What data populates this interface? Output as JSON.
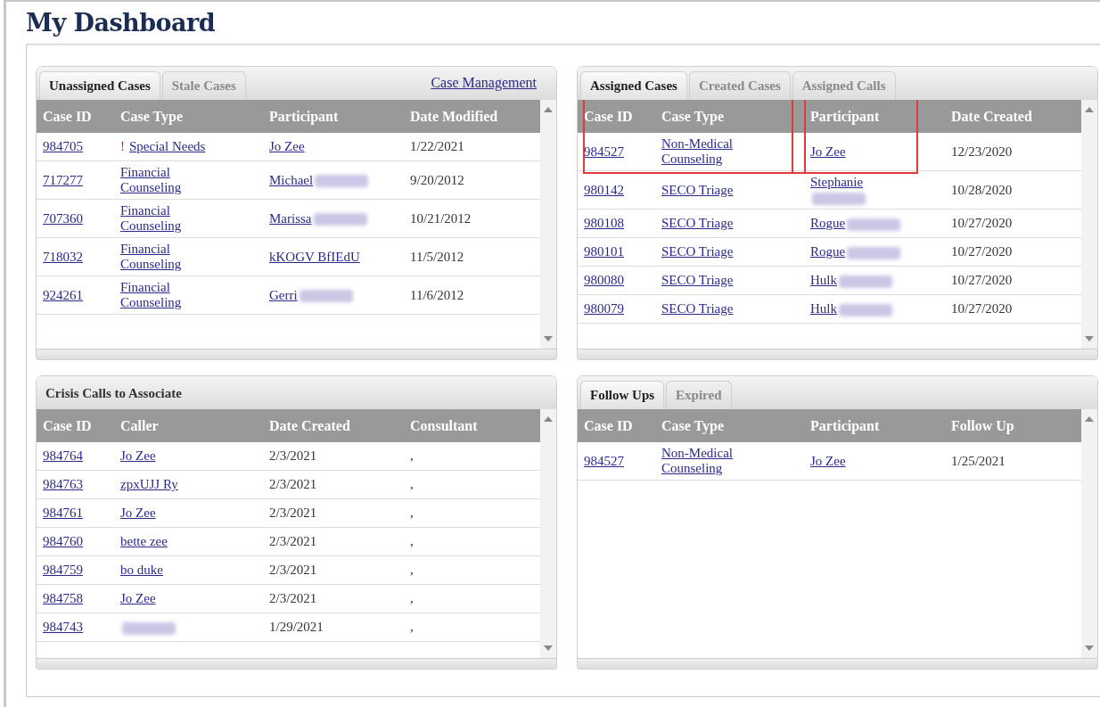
{
  "title": "My Dashboard",
  "panels": [
    {
      "tabs": [
        {
          "label": "Unassigned Cases",
          "selected": true
        },
        {
          "label": "Stale Cases",
          "selected": false
        }
      ],
      "link": "Case Management",
      "columns": [
        {
          "label": "Case ID"
        },
        {
          "label": "Case Type"
        },
        {
          "label": "Participant"
        },
        {
          "label": "Date Modified"
        }
      ],
      "rows": [
        {
          "cells": [
            {
              "text": "984705",
              "link": true
            },
            {
              "text": "Special Needs",
              "link": true,
              "alert": "!"
            },
            {
              "text": "Jo Zee",
              "link": true
            },
            {
              "text": "1/22/2021",
              "link": false
            }
          ]
        },
        {
          "cells": [
            {
              "text": "717277",
              "link": true
            },
            {
              "text": "Financial Counseling",
              "link": true
            },
            {
              "text": "Michael",
              "link": true,
              "redacted": true
            },
            {
              "text": "9/20/2012",
              "link": false
            }
          ]
        },
        {
          "cells": [
            {
              "text": "707360",
              "link": true
            },
            {
              "text": "Financial Counseling",
              "link": true
            },
            {
              "text": "Marissa",
              "link": true,
              "redacted": true
            },
            {
              "text": "10/21/2012",
              "link": false
            }
          ]
        },
        {
          "cells": [
            {
              "text": "718032",
              "link": true
            },
            {
              "text": "Financial Counseling",
              "link": true
            },
            {
              "text": "kKOGV BfIEdU",
              "link": true
            },
            {
              "text": "11/5/2012",
              "link": false
            }
          ]
        },
        {
          "cells": [
            {
              "text": "924261",
              "link": true
            },
            {
              "text": "Financial Counseling",
              "link": true
            },
            {
              "text": "Gerri",
              "link": true,
              "redacted": true
            },
            {
              "text": "11/6/2012",
              "link": false
            }
          ]
        }
      ]
    },
    {
      "tabs": [
        {
          "label": "Assigned Cases",
          "selected": true
        },
        {
          "label": "Created Cases",
          "selected": false
        },
        {
          "label": "Assigned Calls",
          "selected": false
        }
      ],
      "columns": [
        {
          "label": "Case ID",
          "highlighted": true
        },
        {
          "label": "Case Type",
          "highlighted": true,
          "frame_start": false
        },
        {
          "label": "Participant",
          "highlighted": true,
          "frame_start": true
        },
        {
          "label": "Date Created"
        }
      ],
      "rows": [
        {
          "cells": [
            {
              "text": "984527",
              "link": true
            },
            {
              "text": "Non-Medical Counseling",
              "link": true
            },
            {
              "text": "Jo Zee",
              "link": true
            },
            {
              "text": "12/23/2020",
              "link": false
            }
          ]
        },
        {
          "cells": [
            {
              "text": "980142",
              "link": true
            },
            {
              "text": "SECO Triage",
              "link": true
            },
            {
              "text": "Stephanie",
              "link": true,
              "redacted": true,
              "wrap": true
            },
            {
              "text": "10/28/2020",
              "link": false
            }
          ]
        },
        {
          "cells": [
            {
              "text": "980108",
              "link": true
            },
            {
              "text": "SECO Triage",
              "link": true
            },
            {
              "text": "Rogue",
              "link": true,
              "redacted": true
            },
            {
              "text": "10/27/2020",
              "link": false
            }
          ]
        },
        {
          "cells": [
            {
              "text": "980101",
              "link": true
            },
            {
              "text": "SECO Triage",
              "link": true
            },
            {
              "text": "Rogue",
              "link": true,
              "redacted": true
            },
            {
              "text": "10/27/2020",
              "link": false
            }
          ]
        },
        {
          "cells": [
            {
              "text": "980080",
              "link": true
            },
            {
              "text": "SECO Triage",
              "link": true
            },
            {
              "text": "Hulk",
              "link": true,
              "redacted": true
            },
            {
              "text": "10/27/2020",
              "link": false
            }
          ]
        },
        {
          "cells": [
            {
              "text": "980079",
              "link": true
            },
            {
              "text": "SECO Triage",
              "link": true
            },
            {
              "text": "Hulk",
              "link": true,
              "redacted": true
            },
            {
              "text": "10/27/2020",
              "link": false
            }
          ]
        }
      ]
    },
    {
      "title": "Crisis Calls to Associate",
      "columns": [
        {
          "label": "Case ID"
        },
        {
          "label": "Caller"
        },
        {
          "label": "Date Created"
        },
        {
          "label": "Consultant"
        }
      ],
      "rows": [
        {
          "cells": [
            {
              "text": "984764",
              "link": true
            },
            {
              "text": "Jo Zee",
              "link": true
            },
            {
              "text": "2/3/2021",
              "link": false
            },
            {
              "text": ",",
              "link": false
            }
          ]
        },
        {
          "cells": [
            {
              "text": "984763",
              "link": true
            },
            {
              "text": "zpxUJJ Ry",
              "link": true
            },
            {
              "text": "2/3/2021",
              "link": false
            },
            {
              "text": ",",
              "link": false
            }
          ]
        },
        {
          "cells": [
            {
              "text": "984761",
              "link": true
            },
            {
              "text": "Jo Zee",
              "link": true
            },
            {
              "text": "2/3/2021",
              "link": false
            },
            {
              "text": ",",
              "link": false
            }
          ]
        },
        {
          "cells": [
            {
              "text": "984760",
              "link": true
            },
            {
              "text": "bette zee",
              "link": true
            },
            {
              "text": "2/3/2021",
              "link": false
            },
            {
              "text": ",",
              "link": false
            }
          ]
        },
        {
          "cells": [
            {
              "text": "984759",
              "link": true
            },
            {
              "text": "bo duke",
              "link": true
            },
            {
              "text": "2/3/2021",
              "link": false
            },
            {
              "text": ",",
              "link": false
            }
          ]
        },
        {
          "cells": [
            {
              "text": "984758",
              "link": true
            },
            {
              "text": "Jo Zee",
              "link": true
            },
            {
              "text": "2/3/2021",
              "link": false
            },
            {
              "text": ",",
              "link": false
            }
          ]
        },
        {
          "cells": [
            {
              "text": "984743",
              "link": true
            },
            {
              "link": true,
              "redacted": true
            },
            {
              "text": "1/29/2021",
              "link": false
            },
            {
              "text": ",",
              "link": false
            }
          ]
        }
      ]
    },
    {
      "tabs": [
        {
          "label": "Follow Ups",
          "selected": true
        },
        {
          "label": "Expired",
          "selected": false
        }
      ],
      "columns": [
        {
          "label": "Case ID"
        },
        {
          "label": "Case Type"
        },
        {
          "label": "Participant"
        },
        {
          "label": "Follow Up"
        }
      ],
      "rows": [
        {
          "cells": [
            {
              "text": "984527",
              "link": true
            },
            {
              "text": "Non-Medical Counseling",
              "link": true
            },
            {
              "text": "Jo Zee",
              "link": true
            },
            {
              "text": "1/25/2021",
              "link": false
            }
          ]
        }
      ]
    }
  ]
}
